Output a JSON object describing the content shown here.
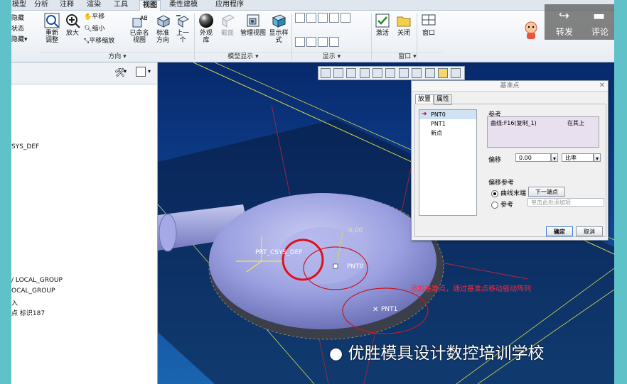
{
  "ribbon": {
    "tabs": [
      "模型",
      "分析",
      "注释",
      "渲染",
      "工具",
      "视图",
      "柔性建模",
      "应用程序"
    ],
    "active_tab": "视图",
    "left_cut_labels": [
      "隐藏",
      "状态",
      "隐藏▾",
      "态"
    ],
    "orientation": {
      "refit": "重新调整",
      "zoom_in": "放大",
      "pan": "平移",
      "zoom_out": "缩小",
      "pan_zoom": "平移缩放",
      "named_views": "已命名视图",
      "standard_orientation": "标准方向",
      "previous": "上一个"
    },
    "model_display": {
      "appearance_gallery": "外观库",
      "section": "截面",
      "manage_views": "管理视图",
      "display_style": "显示样式"
    },
    "window": {
      "activate": "激活",
      "close": "关闭",
      "windows": "窗口"
    },
    "group_labels": [
      "方向",
      "模型显示",
      "显示",
      "窗口"
    ]
  },
  "share": {
    "forward": "转发",
    "comment": "评论"
  },
  "tree": {
    "items": [
      "SYS_DEF",
      "/ LOCAL_GROUP",
      "OCAL_GROUP",
      "入",
      "点 标识187"
    ]
  },
  "viewport": {
    "labels": {
      "csys": "PRT_CSYS_DEF",
      "pnt0": "PNT0",
      "pnt1": "PNT1",
      "offset_value": "0.00",
      "annotation": "添加基准点，通过基准点移动驱动阵列"
    }
  },
  "dialog": {
    "title": "基准点",
    "tabs": [
      "放置",
      "属性"
    ],
    "points": [
      "PNT0",
      "PNT1",
      "新点"
    ],
    "ref_label": "参考",
    "ref_value": "曲线:F16(复制_1)",
    "ref_type": "在其上",
    "offset_label": "偏移",
    "offset_value": "0.00",
    "offset_mode": "比率",
    "offset_ref_label": "偏移参考",
    "curve_end": "曲线末端",
    "next_end": "下一端点",
    "reference": "参考",
    "click_add": "单击此处添加项",
    "ok": "确定",
    "cancel": "取消"
  },
  "watermark": "优胜模具设计数控培训学校"
}
